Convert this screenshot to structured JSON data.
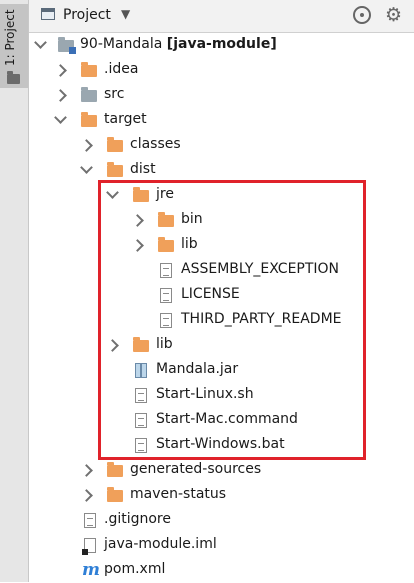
{
  "sidebar": {
    "tab_label": "1: Project"
  },
  "header": {
    "title": "Project",
    "dropdown_glyph": "▼",
    "target_icon": "locate-icon",
    "settings_icon": "gear-icon"
  },
  "tree": {
    "root": {
      "label": "90-Mandala",
      "module_tag": "[java-module]"
    },
    "idea": {
      "label": ".idea"
    },
    "src": {
      "label": "src"
    },
    "target": {
      "label": "target"
    },
    "classes": {
      "label": "classes"
    },
    "dist": {
      "label": "dist"
    },
    "jre": {
      "label": "jre"
    },
    "jre_bin": {
      "label": "bin"
    },
    "jre_lib": {
      "label": "lib"
    },
    "assembly_exception": {
      "label": "ASSEMBLY_EXCEPTION"
    },
    "license": {
      "label": "LICENSE"
    },
    "third_party_readme": {
      "label": "THIRD_PARTY_README"
    },
    "dist_lib": {
      "label": "lib"
    },
    "mandala_jar": {
      "label": "Mandala.jar"
    },
    "start_linux": {
      "label": "Start-Linux.sh"
    },
    "start_mac": {
      "label": "Start-Mac.command"
    },
    "start_windows": {
      "label": "Start-Windows.bat"
    },
    "generated_sources": {
      "label": "generated-sources"
    },
    "maven_status": {
      "label": "maven-status"
    },
    "gitignore": {
      "label": ".gitignore"
    },
    "module_iml": {
      "label": "java-module.iml"
    },
    "pom": {
      "label": "pom.xml",
      "icon_glyph": "m"
    }
  },
  "colors": {
    "folder": "#f0a05a",
    "highlight_border": "#e0222a",
    "maven": "#2f7fd6"
  }
}
